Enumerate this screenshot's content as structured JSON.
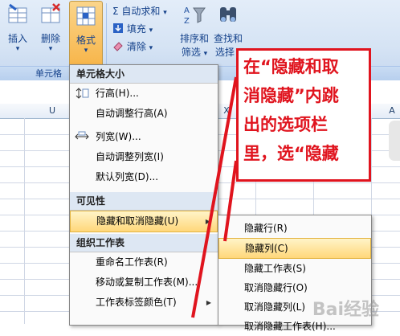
{
  "ribbon": {
    "insert_label": "插入",
    "delete_label": "删除",
    "format_label": "格式",
    "autosum_label": "Σ 自动求和",
    "fill_label": "填充",
    "clear_label": "清除",
    "sort_filter_label1": "排序和",
    "sort_filter_label2": "筛选",
    "find_select_label1": "查找和",
    "find_select_label2": "选择",
    "cells_group_label": "单元格",
    "dropdown_arrow": "▾"
  },
  "grid": {
    "columns": [
      "U",
      "X",
      "Y",
      "Z",
      "A"
    ]
  },
  "format_menu": {
    "section_cell_size": "单元格大小",
    "row_height": "行高(H)...",
    "autofit_row": "自动调整行高(A)",
    "col_width": "列宽(W)...",
    "autofit_col": "自动调整列宽(I)",
    "default_width": "默认列宽(D)...",
    "section_visibility": "可见性",
    "hide_unhide": "隐藏和取消隐藏(U)",
    "section_organize": "组织工作表",
    "rename_sheet": "重命名工作表(R)",
    "move_copy_sheet": "移动或复制工作表(M)...",
    "tab_color": "工作表标签颜色(T)"
  },
  "submenu": {
    "hide_rows": "隐藏行(R)",
    "hide_cols": "隐藏列(C)",
    "hide_sheet": "隐藏工作表(S)",
    "unhide_rows": "取消隐藏行(O)",
    "unhide_cols": "取消隐藏列(L)",
    "unhide_sheet": "取消隐藏工作表(H)..."
  },
  "annotation": {
    "line1": "在“隐藏和取",
    "line2": "消隐藏”内跳",
    "line3": "出的选项栏",
    "line4": "里，选“隐藏"
  },
  "watermark": "Bai经验",
  "colors": {
    "annotation_red": "#e0141e",
    "highlight": "#ffd77a",
    "ribbon_text": "#15428b"
  }
}
